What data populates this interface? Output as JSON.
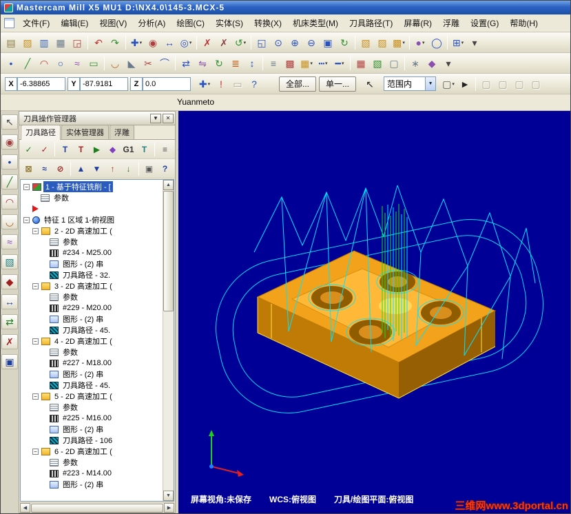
{
  "window": {
    "title": "Mastercam Mill X5 MU1   D:\\NX4.0\\145-3.MCX-5"
  },
  "menu": {
    "items": [
      "文件(F)",
      "编辑(E)",
      "视图(V)",
      "分析(A)",
      "绘图(C)",
      "实体(S)",
      "转换(X)",
      "机床类型(M)",
      "刀具路径(T)",
      "屏幕(R)",
      "浮雕",
      "设置(G)",
      "帮助(H)"
    ]
  },
  "toolbars": {
    "row1": [
      {
        "n": "new-file",
        "g": "▤",
        "c": "#8a7a40"
      },
      {
        "n": "open-file",
        "g": "▨",
        "c": "#c89020"
      },
      {
        "n": "save-file",
        "g": "▥",
        "c": "#3a62b8"
      },
      {
        "n": "print",
        "g": "▦",
        "c": "#6a7a8a"
      },
      {
        "n": "screen-capture",
        "g": "◲",
        "c": "#b04040"
      },
      {
        "sep": true
      },
      {
        "n": "undo",
        "g": "↶",
        "c": "#c03030"
      },
      {
        "n": "redo",
        "g": "↷",
        "c": "#2f8f2f"
      },
      {
        "sep": true
      },
      {
        "n": "autocursor",
        "g": "✚",
        "c": "#2a52c0",
        "d": true
      },
      {
        "n": "analyze-position",
        "g": "◉",
        "c": "#b04040"
      },
      {
        "n": "analyze-distance",
        "g": "↔",
        "c": "#2a52c0"
      },
      {
        "n": "analyze-dynamic",
        "g": "◎",
        "c": "#2a52c0",
        "d": true
      },
      {
        "sep": true
      },
      {
        "n": "delete-entities",
        "g": "✗",
        "c": "#c03030"
      },
      {
        "n": "delete-duplicates",
        "g": "✗",
        "c": "#8a4040"
      },
      {
        "n": "undelete",
        "g": "↺",
        "c": "#2f8f2f",
        "d": true
      },
      {
        "sep": true
      },
      {
        "n": "zoom-window",
        "g": "◱",
        "c": "#2a52c0"
      },
      {
        "n": "zoom-target",
        "g": "⊙",
        "c": "#2a52c0"
      },
      {
        "n": "zoom-in",
        "g": "⊕",
        "c": "#2a52c0"
      },
      {
        "n": "zoom-out",
        "g": "⊖",
        "c": "#2a52c0"
      },
      {
        "n": "fit-screen",
        "g": "▣",
        "c": "#2a52c0"
      },
      {
        "n": "repaint",
        "g": "↻",
        "c": "#2f8f2f"
      },
      {
        "sep": true
      },
      {
        "n": "gview-top",
        "g": "▧",
        "c": "#c89020"
      },
      {
        "n": "gview-front",
        "g": "▨",
        "c": "#c89020"
      },
      {
        "n": "gview-isometric",
        "g": "▩",
        "c": "#c89020",
        "d": true
      },
      {
        "sep": true
      },
      {
        "n": "shading-toggle",
        "g": "●",
        "c": "#8a50b0",
        "d": true
      },
      {
        "n": "wireframe-toggle",
        "g": "◯",
        "c": "#2a52c0"
      },
      {
        "sep": true
      },
      {
        "n": "viewport-layout",
        "g": "⊞",
        "c": "#2a52c0",
        "d": true
      },
      {
        "n": "toolbar1-overflow",
        "g": "▾",
        "c": "#444"
      }
    ],
    "row2": [
      {
        "n": "create-point",
        "g": "•",
        "c": "#2a52c0"
      },
      {
        "n": "create-line",
        "g": "╱",
        "c": "#2f8f2f"
      },
      {
        "n": "create-arc",
        "g": "◠",
        "c": "#c03030"
      },
      {
        "n": "create-circle",
        "g": "○",
        "c": "#2a52c0"
      },
      {
        "n": "create-spline",
        "g": "≈",
        "c": "#8a50b0"
      },
      {
        "n": "create-rectangle",
        "g": "▭",
        "c": "#2f8f2f"
      },
      {
        "sep": true
      },
      {
        "n": "fillet",
        "g": "◡",
        "c": "#c06020"
      },
      {
        "n": "chamfer",
        "g": "◣",
        "c": "#6a7a8a"
      },
      {
        "n": "trim",
        "g": "✂",
        "c": "#b04040"
      },
      {
        "n": "join-entities",
        "g": "⌒",
        "c": "#2a52c0"
      },
      {
        "sep": true
      },
      {
        "n": "xform-translate",
        "g": "⇄",
        "c": "#2a52c0"
      },
      {
        "n": "xform-mirror",
        "g": "⇋",
        "c": "#8a50b0"
      },
      {
        "n": "xform-rotate",
        "g": "↻",
        "c": "#2f8f2f"
      },
      {
        "n": "xform-offset",
        "g": "≣",
        "c": "#c06020"
      },
      {
        "n": "xform-scale",
        "g": "↕",
        "c": "#2a52c0"
      },
      {
        "sep": true
      },
      {
        "n": "levels-manager",
        "g": "≡",
        "c": "#6a7a8a"
      },
      {
        "n": "entity-attributes",
        "g": "▩",
        "c": "#b04040"
      },
      {
        "n": "color-select",
        "g": "▦",
        "c": "#c89020",
        "d": true
      },
      {
        "n": "line-style",
        "g": "┅",
        "c": "#2a52c0",
        "d": true
      },
      {
        "n": "line-width",
        "g": "━",
        "c": "#2a52c0",
        "d": true
      },
      {
        "sep": true
      },
      {
        "n": "grid-settings",
        "g": "▦",
        "c": "#b04040"
      },
      {
        "n": "groups-manager",
        "g": "▧",
        "c": "#2f8f2f"
      },
      {
        "n": "blank-entity",
        "g": "▢",
        "c": "#6a7a8a"
      },
      {
        "sep": true
      },
      {
        "n": "machine-group-properties",
        "g": "∗",
        "c": "#6a7a8a"
      },
      {
        "n": "material-manager",
        "g": "◆",
        "c": "#8a50b0"
      },
      {
        "n": "toolbar2-overflow",
        "g": "▾",
        "c": "#444"
      }
    ]
  },
  "coordbar": {
    "x_label": "X",
    "x_value": "-6.38865",
    "y_label": "Y",
    "y_value": "-87.9181",
    "z_label": "Z",
    "z_value": "0.0",
    "all_label": "全部...",
    "single_label": "单一...",
    "range_label": "范围内",
    "icons_a": [
      {
        "n": "autocursor-override",
        "g": "✚",
        "c": "#2a52c0",
        "d": true
      },
      {
        "n": "fast-point-mode",
        "g": "!",
        "c": "#c03030"
      },
      {
        "n": "guide-ruler",
        "g": "▭",
        "c": "#9a9a8a",
        "disabled": true
      },
      {
        "n": "autocursor-help",
        "g": "?",
        "c": "#2a52c0"
      }
    ],
    "icons_b": [
      {
        "n": "selection-pointer",
        "g": "↖",
        "c": "#222"
      }
    ],
    "icons_c": [
      {
        "n": "window-select",
        "g": "▢",
        "c": "#555",
        "d": true
      },
      {
        "n": "polygon-select",
        "g": "►",
        "c": "#222"
      },
      {
        "sep": true
      },
      {
        "n": "select-result-1",
        "g": "▢",
        "c": "#aaa",
        "disabled": true
      },
      {
        "n": "select-result-2",
        "g": "▢",
        "c": "#aaa",
        "disabled": true
      },
      {
        "n": "select-result-3",
        "g": "▢",
        "c": "#aaa",
        "disabled": true
      },
      {
        "n": "select-result-4",
        "g": "▢",
        "c": "#aaa",
        "disabled": true
      }
    ]
  },
  "brand": "Yuanmeto",
  "left_toolbar": [
    {
      "n": "mru-select",
      "g": "↖",
      "c": "#444"
    },
    {
      "n": "mru-analyze",
      "g": "◉",
      "c": "#9f3f3f"
    },
    {
      "n": "mru-point",
      "g": "•",
      "c": "#1f3f9f"
    },
    {
      "n": "mru-line",
      "g": "╱",
      "c": "#1f7f1f"
    },
    {
      "n": "mru-arc",
      "g": "◠",
      "c": "#9f1f1f"
    },
    {
      "n": "mru-fillet",
      "g": "◡",
      "c": "#b06020"
    },
    {
      "n": "mru-spline",
      "g": "≈",
      "c": "#7f3fbf"
    },
    {
      "n": "mru-surface",
      "g": "▧",
      "c": "#1f7f7f"
    },
    {
      "n": "mru-solid",
      "g": "◆",
      "c": "#9f1f1f"
    },
    {
      "n": "mru-dimension",
      "g": "↔",
      "c": "#1f3f9f"
    },
    {
      "n": "mru-xform",
      "g": "⇄",
      "c": "#1f7f1f"
    },
    {
      "n": "mru-delete",
      "g": "✗",
      "c": "#9f1f1f"
    },
    {
      "n": "mru-screen",
      "g": "▣",
      "c": "#1f3f9f"
    }
  ],
  "panel": {
    "title": "刀具操作管理器",
    "tabs": [
      "刀具路径",
      "实体管理器",
      "浮雕"
    ],
    "active_tab": 0,
    "toolbar1": [
      {
        "n": "select-all-operations",
        "g": "✓",
        "c": "#1f7f1f"
      },
      {
        "n": "select-dirty-operations",
        "g": "✓",
        "c": "#9f1f1f"
      },
      {
        "sep": true
      },
      {
        "n": "regen-selected",
        "g": "T",
        "c": "#1f3f9f"
      },
      {
        "n": "regen-all",
        "g": "T",
        "c": "#9f1f1f"
      },
      {
        "n": "backplot",
        "g": "▶",
        "c": "#1f7f1f"
      },
      {
        "n": "verify",
        "g": "◆",
        "c": "#7f3fbf"
      },
      {
        "n": "post-process",
        "g": "G1",
        "c": "#333"
      },
      {
        "n": "feed-speeds",
        "g": "T",
        "c": "#1f7f7f"
      },
      {
        "sep": true
      },
      {
        "n": "toolpath-properties",
        "g": "≡",
        "c": "#555"
      },
      {
        "n": "ops-disabled",
        "g": "⊘",
        "c": "#999",
        "disabled": true
      }
    ],
    "toolbar2": [
      {
        "n": "lock-operations",
        "g": "⊠",
        "c": "#8a6d1f"
      },
      {
        "n": "toggle-toolpath-display",
        "g": "≈",
        "c": "#1f3f9f"
      },
      {
        "n": "toggle-posting",
        "g": "⊘",
        "c": "#9f1f1f"
      },
      {
        "sep": true
      },
      {
        "n": "move-up",
        "g": "▲",
        "c": "#1f3f9f"
      },
      {
        "n": "move-down",
        "g": "▼",
        "c": "#1f3f9f"
      },
      {
        "n": "insert-arrow-up",
        "g": "↑",
        "c": "#9f1f1f"
      },
      {
        "n": "insert-arrow-down",
        "g": "↓",
        "c": "#1f7f1f"
      },
      {
        "sep": true
      },
      {
        "n": "display-only-selected",
        "g": "▣",
        "c": "#555"
      },
      {
        "n": "ops-help",
        "g": "?",
        "c": "#1f3f9f"
      }
    ],
    "tree": [
      {
        "level": 0,
        "expand": true,
        "icon": "feature-mill",
        "label": "1 - 基于特征铣削 - [",
        "selected": true
      },
      {
        "level": 1,
        "icon": "parameters",
        "label": "参数"
      },
      {
        "level": 0,
        "icon": "insert-arrow",
        "label": ""
      },
      {
        "level": 0,
        "expand": true,
        "icon": "feature",
        "label": "特征 1 区域 1-俯视图"
      },
      {
        "level": 1,
        "expand": true,
        "icon": "operation-folder",
        "label": "2 - 2D 高速加工 ("
      },
      {
        "level": 2,
        "icon": "parameters",
        "label": "参数"
      },
      {
        "level": 2,
        "icon": "tool",
        "label": "#234 - M25.00"
      },
      {
        "level": 2,
        "icon": "geometry",
        "label": "图形 - (2) 串"
      },
      {
        "level": 2,
        "icon": "toolpath",
        "label": "刀具路径 - 32."
      },
      {
        "level": 1,
        "expand": true,
        "icon": "operation-folder",
        "label": "3 - 2D 高速加工 ("
      },
      {
        "level": 2,
        "icon": "parameters",
        "label": "参数"
      },
      {
        "level": 2,
        "icon": "tool",
        "label": "#229 - M20.00"
      },
      {
        "level": 2,
        "icon": "geometry",
        "label": "图形 - (2) 串"
      },
      {
        "level": 2,
        "icon": "toolpath",
        "label": "刀具路径 - 45."
      },
      {
        "level": 1,
        "expand": true,
        "icon": "operation-folder",
        "label": "4 - 2D 高速加工 ("
      },
      {
        "level": 2,
        "icon": "parameters",
        "label": "参数"
      },
      {
        "level": 2,
        "icon": "tool",
        "label": "#227 - M18.00"
      },
      {
        "level": 2,
        "icon": "geometry",
        "label": "图形 - (2) 串"
      },
      {
        "level": 2,
        "icon": "toolpath",
        "label": "刀具路径 - 45."
      },
      {
        "level": 1,
        "expand": true,
        "icon": "operation-folder",
        "label": "5 - 2D 高速加工 ("
      },
      {
        "level": 2,
        "icon": "parameters",
        "label": "参数"
      },
      {
        "level": 2,
        "icon": "tool",
        "label": "#225 - M16.00"
      },
      {
        "level": 2,
        "icon": "geometry",
        "label": "图形 - (2) 串"
      },
      {
        "level": 2,
        "icon": "toolpath",
        "label": "刀具路径 - 106"
      },
      {
        "level": 1,
        "expand": true,
        "icon": "operation-folder",
        "label": "6 - 2D 高速加工 ("
      },
      {
        "level": 2,
        "icon": "parameters",
        "label": "参数"
      },
      {
        "level": 2,
        "icon": "tool",
        "label": "#223 - M14.00"
      },
      {
        "level": 2,
        "icon": "geometry",
        "label": "图形 - (2) 串"
      }
    ]
  },
  "viewport": {
    "background": "#000096",
    "statusbar": {
      "view": "屏幕视角:未保存",
      "wcs": "WCS:俯视图",
      "plane": "刀具/绘图平面:俯视图"
    },
    "watermark": "三维网www.3dportal.cn",
    "model_colors": {
      "part": "#F2A21B",
      "toolpath": "#00E5FF",
      "retract": "#16E016"
    }
  }
}
